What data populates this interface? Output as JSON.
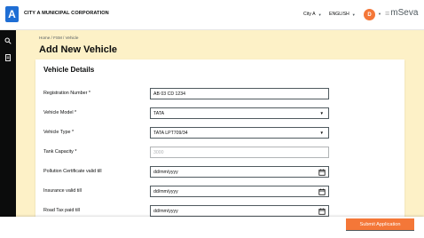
{
  "header": {
    "logo_letter": "A",
    "corporation_name": "CITY A MUNICIPAL CORPORATION",
    "city": "City A",
    "language": "ENGLISH",
    "avatar_initial": "D",
    "brand": "mSeva"
  },
  "sidebar": {
    "icons": [
      "search-icon",
      "document-icon"
    ]
  },
  "breadcrumb": "Home / FSM / Vehicle",
  "page_title": "Add New Vehicle",
  "card": {
    "title": "Vehicle Details",
    "fields": [
      {
        "label": "Registration Number *",
        "value": "AB 03 CD 1234",
        "type": "text"
      },
      {
        "label": "Vehicle Model *",
        "value": "TATA",
        "type": "select"
      },
      {
        "label": "Vehicle Type *",
        "value": "TATA LPT709/34",
        "type": "select"
      },
      {
        "label": "Tank Capacity *",
        "value": "3000",
        "type": "disabled"
      },
      {
        "label": "Pollution Certificate valid till",
        "value": "dd/mm/yyyy",
        "type": "date"
      },
      {
        "label": "Insurance valid till",
        "value": "dd/mm/yyyy",
        "type": "date"
      },
      {
        "label": "Road Tax paid till",
        "value": "dd/mm/yyyy",
        "type": "date"
      }
    ]
  },
  "footer": {
    "submit_label": "Submit Application"
  },
  "colors": {
    "accent": "#f47738",
    "logo_blue": "#1f6ed4",
    "sidebar": "#0b0c0c",
    "page_bg": "#fdf1c7"
  }
}
